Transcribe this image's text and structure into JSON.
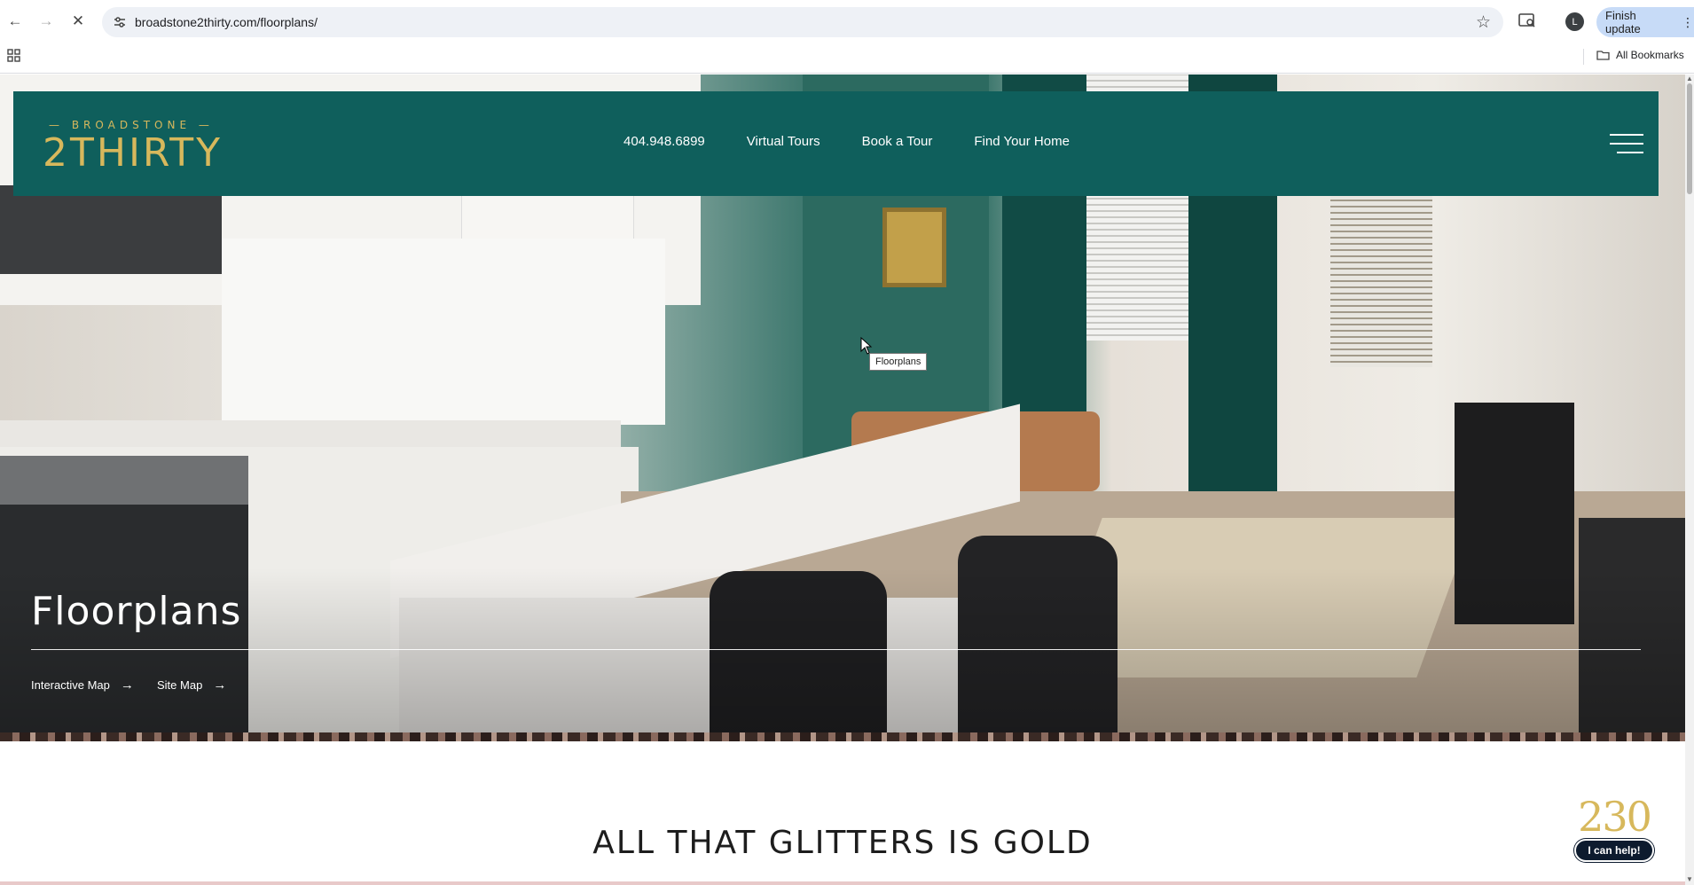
{
  "browser": {
    "url": "broadstone2thirty.com/floorplans/",
    "finish_update_label": "Finish update",
    "all_bookmarks_label": "All Bookmarks",
    "profile_initial": "L"
  },
  "header": {
    "logo_top": "BROADSTONE",
    "logo_main": "2THIRTY",
    "nav": [
      "404.948.6899",
      "Virtual Tours",
      "Book a Tour",
      "Find Your Home"
    ]
  },
  "hero": {
    "title": "Floorplans",
    "links": [
      "Interactive Map",
      "Site Map"
    ],
    "tooltip": "Floorplans"
  },
  "section": {
    "heading": "ALL THAT GLITTERS IS GOLD"
  },
  "chat": {
    "logo": "230",
    "button_label": "I can help!"
  },
  "colors": {
    "header_bg": "#0f5f5c",
    "gold": "#d7b85c",
    "chat_button": "#0d1b2e"
  }
}
